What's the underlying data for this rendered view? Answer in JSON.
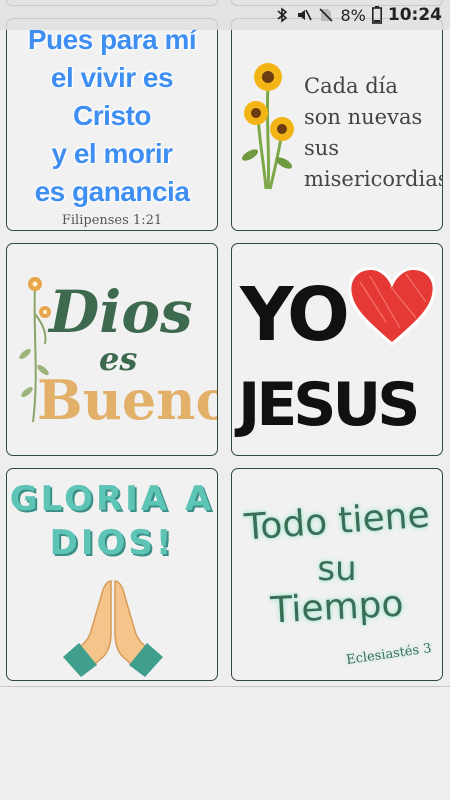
{
  "status_bar": {
    "battery_percent": "8%",
    "time": "10:24",
    "icons": [
      "bluetooth-icon",
      "mute-icon",
      "no-sim-icon",
      "battery-icon"
    ]
  },
  "stickers": [
    {
      "lines": [
        "Pues para mí",
        "el vivir es",
        "Cristo",
        "y el morir",
        "es ganancia"
      ],
      "reference": "Filipenses 1:21",
      "color": "#3f8ff2"
    },
    {
      "lines": [
        "Cada día",
        "son nuevas",
        "sus",
        "misericordias"
      ],
      "icon": "sunflower-icon"
    },
    {
      "word1": "Dios",
      "word2": "es",
      "word3": "Bueno",
      "icon": "flower-branch-icon",
      "colors": {
        "green": "#3d6a4f",
        "gold": "#e3b06a"
      }
    },
    {
      "word1": "YO",
      "word2": "JESUS",
      "icon": "heart-icon",
      "heart_color": "#e53935"
    },
    {
      "line1": "GLORIA A",
      "line2": "DIOS!",
      "icon": "praying-hands-icon",
      "color": "#5ec4b6"
    },
    {
      "lines": [
        "Todo tiene",
        "su",
        "Tiempo"
      ],
      "reference": "Eclesiastés 3"
    }
  ]
}
